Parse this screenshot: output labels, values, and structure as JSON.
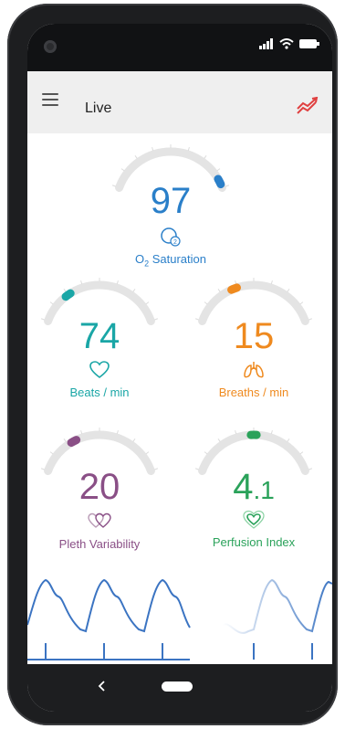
{
  "app": {
    "title": "Live"
  },
  "icons": {
    "menu": "hamburger-menu-icon",
    "trend": "trend-chart-icon",
    "back": "back-chevron-icon",
    "home": "home-pill-icon",
    "o2": "oxygen-o2-icon",
    "heart": "heart-icon",
    "lungs": "lungs-icon",
    "pleth": "pleth-variability-icon",
    "perfusion": "perfusion-heart-icon"
  },
  "colors": {
    "o2": "#2a7fc9",
    "beats": "#1aa6a6",
    "breaths": "#ef8a1f",
    "pleth": "#8a4f86",
    "perfusion": "#2aa25a",
    "trend": "#e04040",
    "wave": "#3b74c2"
  },
  "gauges": {
    "o2": {
      "value": "97",
      "label_prefix": "O",
      "label_sub": "2",
      "label_suffix": " Saturation",
      "icon_sub": "2",
      "level": 0.95
    },
    "beats": {
      "value": "74",
      "label": "Beats / min",
      "level": 0.25
    },
    "breaths": {
      "value": "15",
      "label": "Breaths / min",
      "level": 0.35
    },
    "pleth": {
      "value": "20",
      "label": "Pleth Variability",
      "level": 0.3
    },
    "perfusion": {
      "value_main": "4",
      "value_small": ".1",
      "label": "Perfusion Index",
      "level": 0.5
    }
  }
}
